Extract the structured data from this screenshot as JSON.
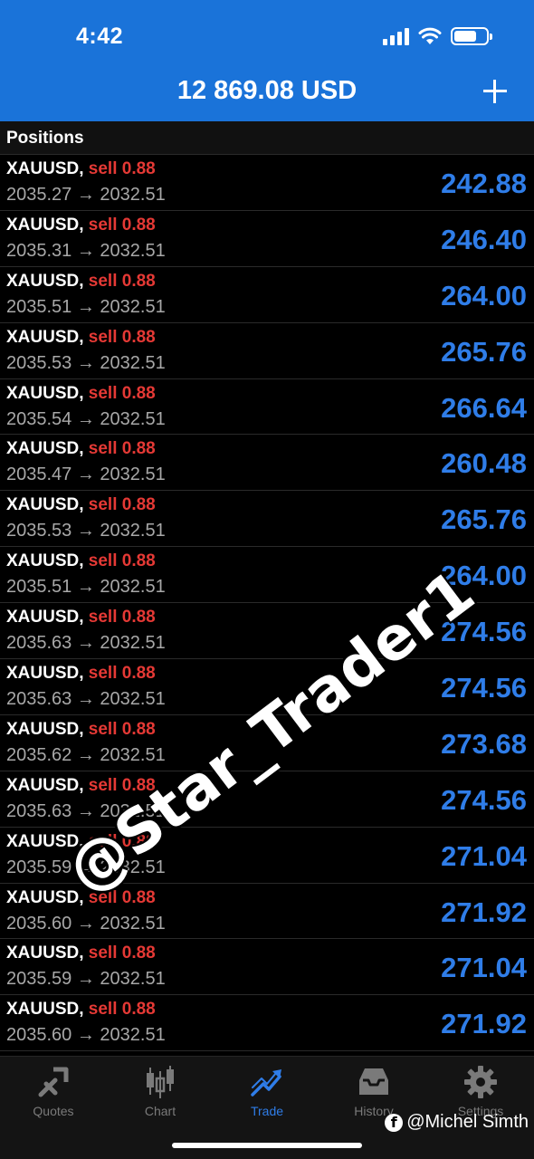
{
  "status_bar": {
    "time": "4:42"
  },
  "header": {
    "balance": "12 869.08 USD"
  },
  "section": {
    "title": "Positions"
  },
  "positions": [
    {
      "symbol": "XAUUSD,",
      "side": "sell 0.88",
      "prices": "2035.27 → 2032.51",
      "profit": "242.88"
    },
    {
      "symbol": "XAUUSD,",
      "side": "sell 0.88",
      "prices": "2035.31 → 2032.51",
      "profit": "246.40"
    },
    {
      "symbol": "XAUUSD,",
      "side": "sell 0.88",
      "prices": "2035.51 → 2032.51",
      "profit": "264.00"
    },
    {
      "symbol": "XAUUSD,",
      "side": "sell 0.88",
      "prices": "2035.53 → 2032.51",
      "profit": "265.76"
    },
    {
      "symbol": "XAUUSD,",
      "side": "sell 0.88",
      "prices": "2035.54 → 2032.51",
      "profit": "266.64"
    },
    {
      "symbol": "XAUUSD,",
      "side": "sell 0.88",
      "prices": "2035.47 → 2032.51",
      "profit": "260.48"
    },
    {
      "symbol": "XAUUSD,",
      "side": "sell 0.88",
      "prices": "2035.53 → 2032.51",
      "profit": "265.76"
    },
    {
      "symbol": "XAUUSD,",
      "side": "sell 0.88",
      "prices": "2035.51 → 2032.51",
      "profit": "264.00"
    },
    {
      "symbol": "XAUUSD,",
      "side": "sell 0.88",
      "prices": "2035.63 → 2032.51",
      "profit": "274.56"
    },
    {
      "symbol": "XAUUSD,",
      "side": "sell 0.88",
      "prices": "2035.63 → 2032.51",
      "profit": "274.56"
    },
    {
      "symbol": "XAUUSD,",
      "side": "sell 0.88",
      "prices": "2035.62 → 2032.51",
      "profit": "273.68"
    },
    {
      "symbol": "XAUUSD,",
      "side": "sell 0.88",
      "prices": "2035.63 → 2032.51",
      "profit": "274.56"
    },
    {
      "symbol": "XAUUSD,",
      "side": "sell 0.88",
      "prices": "2035.59 → 2032.51",
      "profit": "271.04"
    },
    {
      "symbol": "XAUUSD,",
      "side": "sell 0.88",
      "prices": "2035.60 → 2032.51",
      "profit": "271.92"
    },
    {
      "symbol": "XAUUSD,",
      "side": "sell 0.88",
      "prices": "2035.59 → 2032.51",
      "profit": "271.04"
    },
    {
      "symbol": "XAUUSD,",
      "side": "sell 0.88",
      "prices": "2035.60 → 2032.51",
      "profit": "271.92"
    }
  ],
  "tabs": [
    {
      "label": "Quotes",
      "icon": "quotes-icon",
      "active": false
    },
    {
      "label": "Chart",
      "icon": "chart-icon",
      "active": false
    },
    {
      "label": "Trade",
      "icon": "trade-icon",
      "active": true
    },
    {
      "label": "History",
      "icon": "history-icon",
      "active": false
    },
    {
      "label": "Settings",
      "icon": "settings-icon",
      "active": false
    }
  ],
  "watermark": {
    "text": "@Star_Trader1",
    "credit": "@Michel Simth"
  },
  "colors": {
    "header": "#1a73d9",
    "profit": "#2f7de8",
    "sell": "#e53935",
    "active_tab": "#2f7de8"
  }
}
